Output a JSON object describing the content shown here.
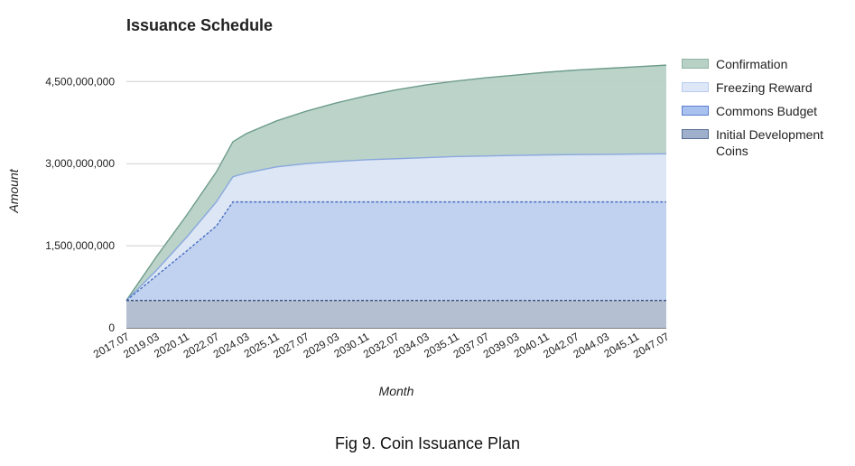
{
  "chart_data": {
    "type": "area",
    "stacked": false,
    "title": "Issuance Schedule",
    "xlabel": "Month",
    "ylabel": "Amount",
    "ylim": [
      0,
      5000000000
    ],
    "y_ticks": [
      0,
      1500000000,
      3000000000,
      4500000000
    ],
    "y_tick_labels": [
      "0",
      "1,500,000,000",
      "3,000,000,000",
      "4,500,000,000"
    ],
    "x_tick_labels": [
      "2017.07",
      "2019.03",
      "2020.11",
      "2022.07",
      "2024.03",
      "2025.11",
      "2027.07",
      "2029.03",
      "2030.11",
      "2032.07",
      "2034.03",
      "2035.11",
      "2037.07",
      "2039.03",
      "2040.11",
      "2042.07",
      "2044.03",
      "2045.11",
      "2047.07"
    ],
    "grid": true,
    "legend_position": "right",
    "x_points": [
      "2017.07",
      "2019.03",
      "2020.11",
      "2022.07",
      "2023.07",
      "2024.03",
      "2025.11",
      "2027.07",
      "2029.03",
      "2030.11",
      "2032.07",
      "2034.03",
      "2035.11",
      "2037.07",
      "2039.03",
      "2040.11",
      "2042.07",
      "2044.03",
      "2045.11",
      "2047.07"
    ],
    "series": [
      {
        "name": "Confirmation",
        "color": "#b7d1c6",
        "stroke": "#6e9c8c",
        "values": [
          500000000,
          1300000000,
          2050000000,
          2850000000,
          3400000000,
          3550000000,
          3780000000,
          3960000000,
          4110000000,
          4240000000,
          4350000000,
          4440000000,
          4510000000,
          4570000000,
          4620000000,
          4670000000,
          4710000000,
          4740000000,
          4770000000,
          4800000000
        ]
      },
      {
        "name": "Freezing Reward",
        "color": "#dde7f7",
        "stroke": "#8aa8de",
        "values": [
          500000000,
          1050000000,
          1650000000,
          2300000000,
          2760000000,
          2830000000,
          2940000000,
          3000000000,
          3040000000,
          3070000000,
          3090000000,
          3110000000,
          3130000000,
          3140000000,
          3150000000,
          3160000000,
          3165000000,
          3170000000,
          3175000000,
          3180000000
        ]
      },
      {
        "name": "Commons Budget",
        "color": "#bfd1f0",
        "stroke": "#4a6fc0",
        "values": [
          500000000,
          950000000,
          1400000000,
          1860000000,
          2300000000,
          2300000000,
          2300000000,
          2300000000,
          2300000000,
          2300000000,
          2300000000,
          2300000000,
          2300000000,
          2300000000,
          2300000000,
          2300000000,
          2300000000,
          2300000000,
          2300000000,
          2300000000
        ]
      },
      {
        "name": "Initial Development Coins",
        "color": "#b3bed0",
        "stroke": "#3a4f78",
        "values": [
          500000000,
          500000000,
          500000000,
          500000000,
          500000000,
          500000000,
          500000000,
          500000000,
          500000000,
          500000000,
          500000000,
          500000000,
          500000000,
          500000000,
          500000000,
          500000000,
          500000000,
          500000000,
          500000000,
          500000000
        ]
      }
    ],
    "legend": [
      {
        "label": "Confirmation",
        "color": "#b7d1c6",
        "border": "#8fb3a5"
      },
      {
        "label": "Freezing Reward",
        "color": "#dde7f7",
        "border": "#b8cbee"
      },
      {
        "label": "Commons Budget",
        "color": "#a9c1ee",
        "border": "#5b7fd0"
      },
      {
        "label": "Initial Development Coins",
        "color": "#9eb0cc",
        "border": "#5a6f94"
      }
    ]
  },
  "caption": "Fig 9. Coin Issuance Plan"
}
